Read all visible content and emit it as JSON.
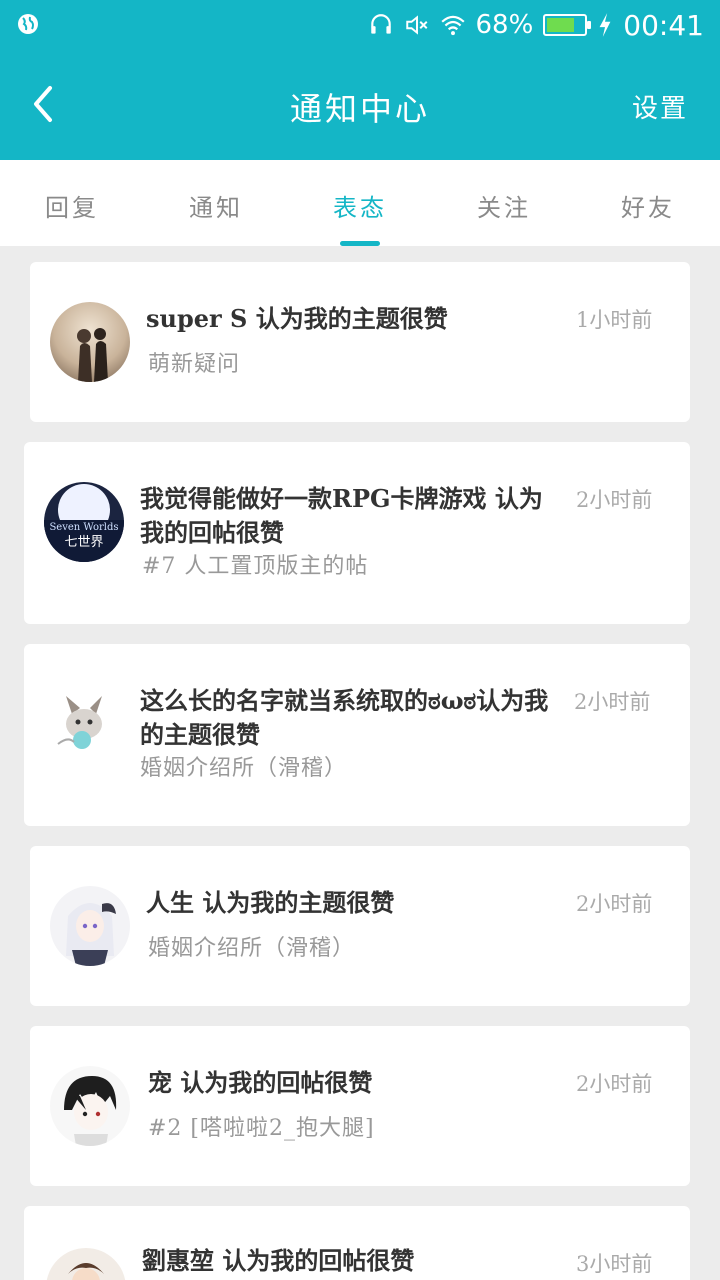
{
  "status_bar": {
    "battery": "68%",
    "battery_level": 0.68,
    "time": "00:41"
  },
  "header": {
    "title": "通知中心",
    "settings": "设置"
  },
  "tabs": [
    {
      "label": "回复"
    },
    {
      "label": "通知"
    },
    {
      "label": "表态",
      "active": true
    },
    {
      "label": "关注"
    },
    {
      "label": "好友"
    }
  ],
  "notifications": [
    {
      "title": "super S 认为我的主题很赞",
      "subtitle": "萌新疑问",
      "time": "1小时前"
    },
    {
      "title": "我觉得能做好一款RPG卡牌游戏 认为我的回帖很赞",
      "subtitle": "#7 人工置顶版主的帖",
      "time": "2小时前"
    },
    {
      "title": "这么长的名字就当系统取的ಠωಠ认为我的主题很赞",
      "subtitle": "婚姻介绍所（滑稽）",
      "time": "2小时前"
    },
    {
      "title": "人生 认为我的主题很赞",
      "subtitle": "婚姻介绍所（滑稽）",
      "time": "2小时前"
    },
    {
      "title": "宠 认为我的回帖很赞",
      "subtitle": "#2 [嗒啦啦2_抱大腿]",
      "time": "2小时前"
    },
    {
      "title": "劉惠堃 认为我的回帖很赞",
      "subtitle": "",
      "time": "3小时前"
    }
  ],
  "colors": {
    "accent": "#14b6c6",
    "background": "#ececec"
  }
}
